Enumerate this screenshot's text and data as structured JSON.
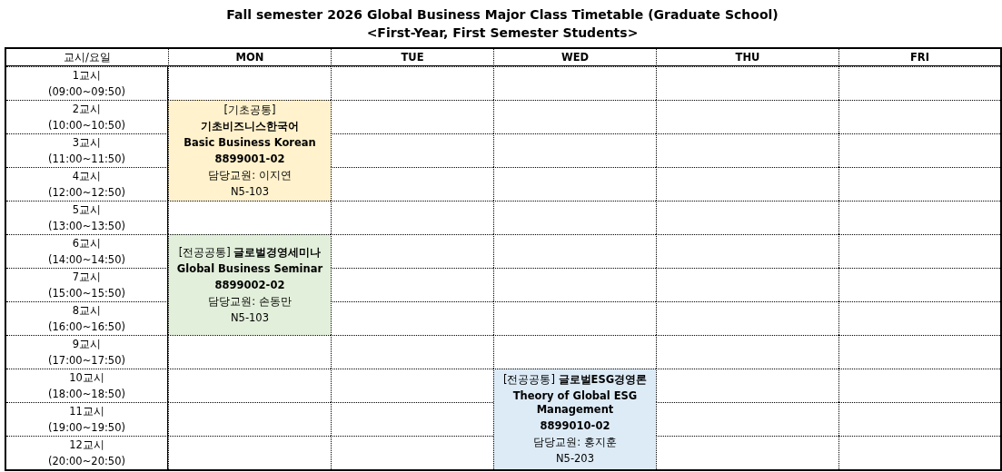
{
  "title": "Fall semester 2026 Global Business Major Class Timetable (Graduate School)",
  "subtitle": "<First-Year, First Semester Students>",
  "corner_header": "교시/요일",
  "days": [
    "MON",
    "TUE",
    "WED",
    "THU",
    "FRI"
  ],
  "rows": [
    {
      "period": "1교시",
      "time": "(09:00~09:50)",
      "cells": [
        {
          "kind": "empty"
        },
        {
          "kind": "empty"
        },
        {
          "kind": "empty"
        },
        {
          "kind": "empty"
        },
        {
          "kind": "empty"
        }
      ]
    },
    {
      "period": "2교시",
      "time": "(10:00~10:50)",
      "cells": [
        {
          "kind": "course",
          "color": "#fff2cc",
          "lines": [
            {
              "text": "[기초공통]",
              "bold": false
            },
            {
              "text": "기초비즈니스한국어",
              "bold": true
            },
            {
              "text": "Basic Business Korean",
              "bold": true
            },
            {
              "text": "8899001-02",
              "bold": true
            },
            {
              "text": "담당교원: 이지연",
              "bold": false
            },
            {
              "text": "N5-103",
              "bold": false
            }
          ]
        },
        {
          "kind": "empty"
        },
        {
          "kind": "empty"
        },
        {
          "kind": "empty"
        },
        {
          "kind": "empty"
        }
      ]
    },
    {
      "period": "3교시",
      "time": "(11:00~11:50)",
      "cells": [
        {
          "kind": "merged"
        },
        {
          "kind": "empty"
        },
        {
          "kind": "empty"
        },
        {
          "kind": "empty"
        },
        {
          "kind": "empty"
        }
      ]
    },
    {
      "period": "4교시",
      "time": "(12:00~12:50)",
      "cells": [
        {
          "kind": "merged"
        },
        {
          "kind": "empty"
        },
        {
          "kind": "empty"
        },
        {
          "kind": "empty"
        },
        {
          "kind": "empty"
        }
      ]
    },
    {
      "period": "5교시",
      "time": "(13:00~13:50)",
      "cells": [
        {
          "kind": "empty"
        },
        {
          "kind": "empty"
        },
        {
          "kind": "empty"
        },
        {
          "kind": "empty"
        },
        {
          "kind": "empty"
        }
      ]
    },
    {
      "period": "6교시",
      "time": "(14:00~14:50)",
      "cells": [
        {
          "kind": "course",
          "color": "#e2efda",
          "lines": [
            {
              "text": "[전공공통] **글로벌경영세미나**",
              "bold": false
            },
            {
              "text": "Global Business Seminar",
              "bold": true
            },
            {
              "text": "8899002-02",
              "bold": true
            },
            {
              "text": "담당교원: 손동만",
              "bold": false
            },
            {
              "text": "N5-103",
              "bold": false
            }
          ]
        },
        {
          "kind": "empty"
        },
        {
          "kind": "empty"
        },
        {
          "kind": "empty"
        },
        {
          "kind": "empty"
        }
      ]
    },
    {
      "period": "7교시",
      "time": "(15:00~15:50)",
      "cells": [
        {
          "kind": "merged"
        },
        {
          "kind": "empty"
        },
        {
          "kind": "empty"
        },
        {
          "kind": "empty"
        },
        {
          "kind": "empty"
        }
      ]
    },
    {
      "period": "8교시",
      "time": "(16:00~16:50)",
      "cells": [
        {
          "kind": "merged"
        },
        {
          "kind": "empty"
        },
        {
          "kind": "empty"
        },
        {
          "kind": "empty"
        },
        {
          "kind": "empty"
        }
      ]
    },
    {
      "period": "9교시",
      "time": "(17:00~17:50)",
      "cells": [
        {
          "kind": "empty"
        },
        {
          "kind": "empty"
        },
        {
          "kind": "empty"
        },
        {
          "kind": "empty"
        },
        {
          "kind": "empty"
        }
      ]
    },
    {
      "period": "10교시",
      "time": "(18:00~18:50)",
      "cells": [
        {
          "kind": "empty"
        },
        {
          "kind": "empty"
        },
        {
          "kind": "course",
          "color": "#ddebf7",
          "lines": [
            {
              "text": "[전공공통] **글로벌ESG경영론**",
              "bold": false
            },
            {
              "text": "Theory of Global ESG Management",
              "bold": true
            },
            {
              "text": "8899010-02",
              "bold": true
            },
            {
              "text": "담당교원: 홍지훈",
              "bold": false
            },
            {
              "text": "N5-203",
              "bold": false
            }
          ]
        },
        {
          "kind": "empty"
        },
        {
          "kind": "empty"
        }
      ]
    },
    {
      "period": "11교시",
      "time": "(19:00~19:50)",
      "cells": [
        {
          "kind": "empty"
        },
        {
          "kind": "empty"
        },
        {
          "kind": "merged"
        },
        {
          "kind": "empty"
        },
        {
          "kind": "empty"
        }
      ]
    },
    {
      "period": "12교시",
      "time": "(20:00~20:50)",
      "cells": [
        {
          "kind": "empty"
        },
        {
          "kind": "empty"
        },
        {
          "kind": "merged"
        },
        {
          "kind": "empty"
        },
        {
          "kind": "empty"
        }
      ]
    }
  ]
}
